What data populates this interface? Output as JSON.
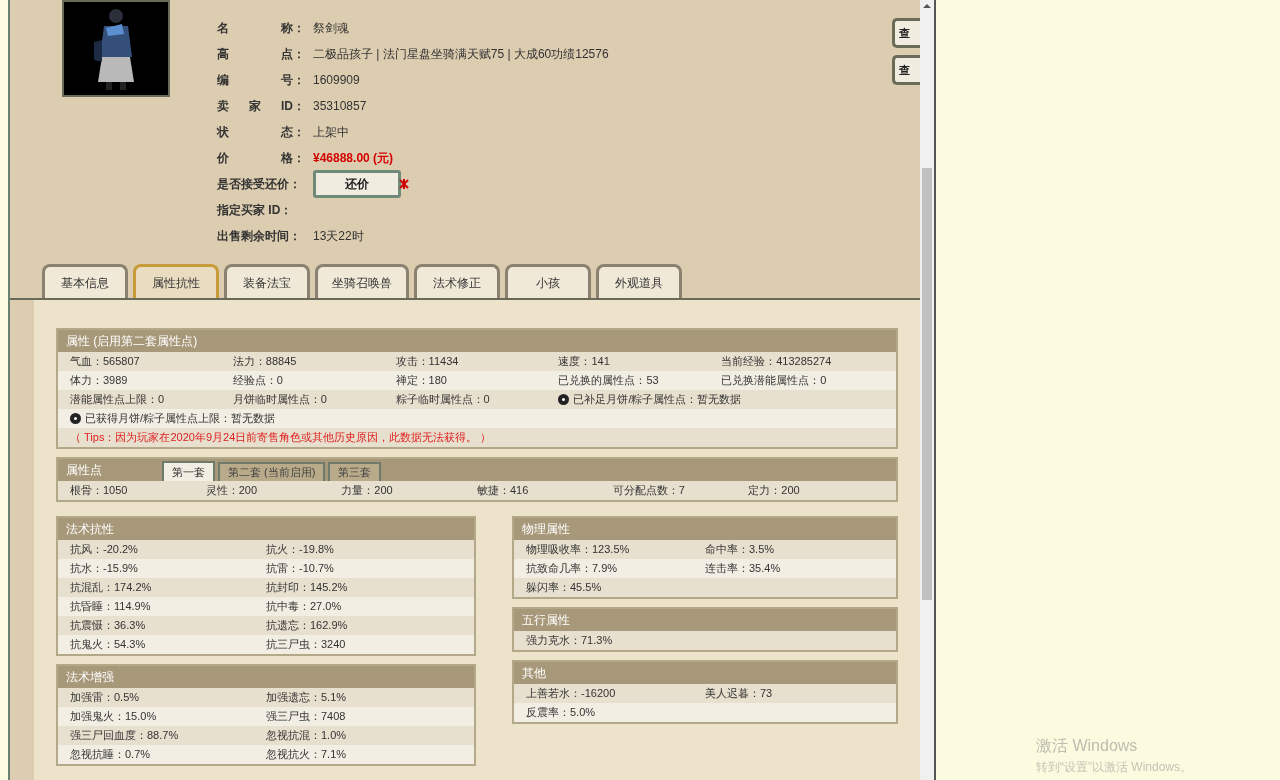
{
  "info_rows": [
    {
      "kind": "plain",
      "label": "名 称",
      "colon": "：",
      "value": "祭剑魂"
    },
    {
      "kind": "plain",
      "label": "高 点",
      "colon": "：",
      "value": "二极品孩子 | 法门星盘坐骑满天赋75 | 大成60功绩12576"
    },
    {
      "kind": "plain",
      "label": "编 号",
      "colon": "：",
      "value": "1609909"
    },
    {
      "kind": "plain",
      "label": "卖 家 ID",
      "colon": "：",
      "value": "35310857"
    },
    {
      "kind": "plain",
      "label": "状 态",
      "colon": "：",
      "value": "上架中"
    },
    {
      "kind": "price",
      "label": "价 格",
      "colon": "：",
      "value": "¥46888.00 (元)"
    },
    {
      "kind": "button",
      "label": "是否接受还价",
      "colon": "：",
      "value": "还价"
    },
    {
      "kind": "bold",
      "label": "指定买家 ID",
      "colon": "："
    },
    {
      "kind": "bold",
      "label": "出售剩余时间",
      "colon": "：",
      "value": "13天22时"
    }
  ],
  "side_buttons": [
    "查",
    "查"
  ],
  "tabs": [
    {
      "label": "基本信息",
      "selected": false
    },
    {
      "label": "属性抗性",
      "selected": true
    },
    {
      "label": "装备法宝",
      "selected": false
    },
    {
      "label": "坐骑召唤兽",
      "selected": false
    },
    {
      "label": "法术修正",
      "selected": false
    },
    {
      "label": "小孩",
      "selected": false
    },
    {
      "label": "外观道具",
      "selected": false
    }
  ],
  "attributes": {
    "title": "属性 (启用第二套属性点)",
    "rows": [
      [
        "气血：565807",
        "法力：88845",
        "攻击：11434",
        "速度：141",
        "当前经验：413285274"
      ],
      [
        "体力：3989",
        "经验点：0",
        "禅定：180",
        "已兑换的属性点：53",
        "已兑换潜能属性点：0"
      ],
      [
        "潜能属性点上限：0",
        "月饼临时属性点：0",
        "粽子临时属性点：0",
        {
          "text": "已补足月饼/粽子属性点：暂无数据",
          "help": true
        }
      ],
      [
        {
          "text": "已获得月饼/粽子属性点上限：暂无数据",
          "help": true
        }
      ]
    ],
    "tips": "（ Tips：因为玩家在2020年9月24日前寄售角色或其他历史原因，此数据无法获得。 ）"
  },
  "attribute_points": {
    "title": "属性点",
    "tabs": [
      {
        "label": "第一套",
        "selected": true
      },
      {
        "label": "第二套 (当前启用)",
        "selected": false
      },
      {
        "label": "第三套",
        "selected": false
      }
    ],
    "values": [
      "根骨：1050",
      "灵性：200",
      "力量：200",
      "敏捷：416",
      "可分配点数：7",
      "定力：200"
    ]
  },
  "left_panels": [
    {
      "title": "法术抗性",
      "rows": [
        [
          "抗风：-20.2%",
          "抗火：-19.8%"
        ],
        [
          "抗水：-15.9%",
          "抗雷：-10.7%"
        ],
        [
          "抗混乱：174.2%",
          "抗封印：145.2%"
        ],
        [
          "抗昏睡：114.9%",
          "抗中毒：27.0%"
        ],
        [
          "抗震慑：36.3%",
          "抗遗忘：162.9%"
        ],
        [
          "抗鬼火：54.3%",
          "抗三尸虫：3240"
        ]
      ]
    },
    {
      "title": "法术增强",
      "rows": [
        [
          "加强雷：0.5%",
          "加强遗忘：5.1%"
        ],
        [
          "加强鬼火：15.0%",
          "强三尸虫：7408"
        ],
        [
          "强三尸回血度：88.7%",
          "忽视抗混：1.0%"
        ],
        [
          "忽视抗睡：0.7%",
          "忽视抗火：7.1%"
        ]
      ]
    }
  ],
  "right_panels": [
    {
      "title": "物理属性",
      "rows": [
        [
          "物理吸收率：123.5%",
          "命中率：3.5%"
        ],
        [
          "抗致命几率：7.9%",
          "连击率：35.4%"
        ],
        [
          "躲闪率：45.5%"
        ]
      ]
    },
    {
      "title": "五行属性",
      "rows": [
        [
          "强力克水：71.3%"
        ]
      ]
    },
    {
      "title": "其他",
      "rows": [
        [
          "上善若水：-16200",
          "美人迟暮：73"
        ],
        [
          "反震率：5.0%"
        ]
      ]
    }
  ],
  "activation": {
    "title": "激活 Windows",
    "subtitle": "转到“设置”以激活 Windows。"
  }
}
